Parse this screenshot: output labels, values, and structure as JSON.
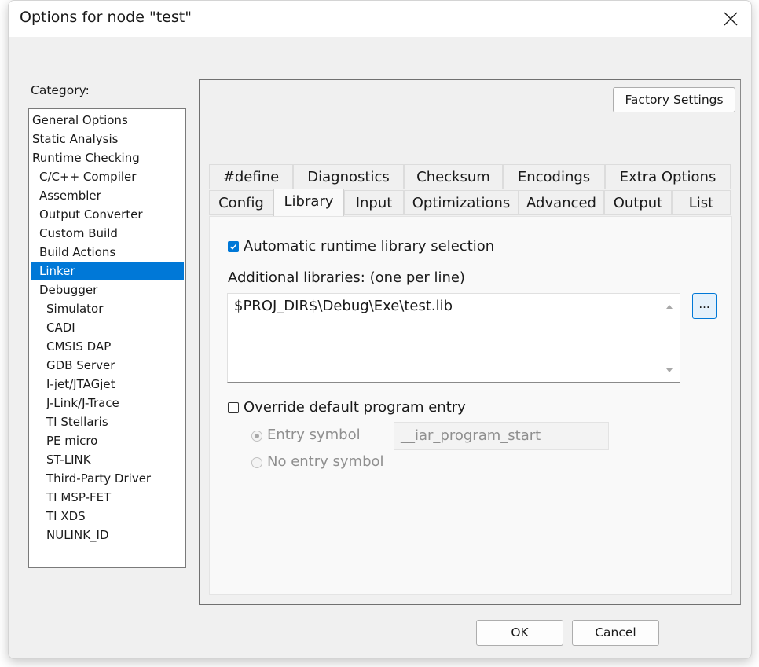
{
  "window": {
    "title": "Options for node \"test\""
  },
  "category": {
    "label": "Category:",
    "items": [
      "General Options",
      "Static Analysis",
      "Runtime Checking",
      "C/C++ Compiler",
      "Assembler",
      "Output Converter",
      "Custom Build",
      "Build Actions",
      "Linker",
      "Debugger",
      "Simulator",
      "CADI",
      "CMSIS DAP",
      "GDB Server",
      "I-jet/JTAGjet",
      "J-Link/J-Trace",
      "TI Stellaris",
      "PE micro",
      "ST-LINK",
      "Third-Party Driver",
      "TI MSP-FET",
      "TI XDS",
      "NULINK_ID"
    ],
    "selected": "Linker"
  },
  "panel": {
    "factory_settings": "Factory Settings",
    "tabs_row1": [
      "#define",
      "Diagnostics",
      "Checksum",
      "Encodings",
      "Extra Options"
    ],
    "tabs_row2": [
      "Config",
      "Library",
      "Input",
      "Optimizations",
      "Advanced",
      "Output",
      "List"
    ],
    "active_tab": "Library"
  },
  "library": {
    "auto_runtime": {
      "label": "Automatic runtime library selection",
      "checked": true
    },
    "additional_label": "Additional libraries: (one per line)",
    "additional_value": "$PROJ_DIR$\\Debug\\Exe\\test.lib",
    "browse_label": "...",
    "override_entry": {
      "label": "Override default program entry",
      "checked": false
    },
    "entry_symbol": {
      "label": "Entry symbol",
      "selected": true,
      "value": "__iar_program_start"
    },
    "no_entry_symbol": {
      "label": "No entry symbol",
      "selected": false
    }
  },
  "footer": {
    "ok": "OK",
    "cancel": "Cancel"
  },
  "colors": {
    "accent": "#0078d7",
    "selection": "#0078d7",
    "disabled_text": "#8f8f8f"
  }
}
